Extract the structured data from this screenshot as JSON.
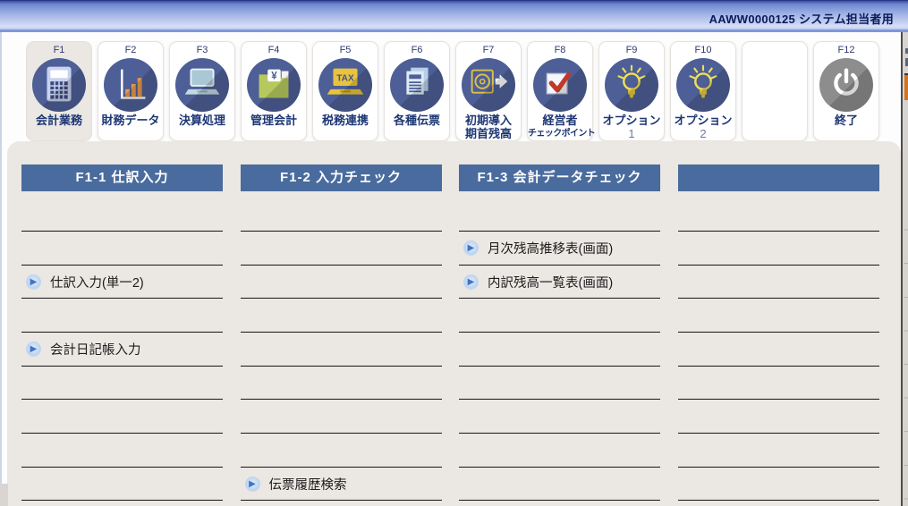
{
  "titlebar": {
    "label": "AAWW0000125 システム担当者用"
  },
  "tabs": [
    {
      "fkey": "F1",
      "label": "会計業務",
      "label2": "",
      "icon": "calculator-icon",
      "active": true
    },
    {
      "fkey": "F2",
      "label": "財務データ",
      "label2": "",
      "icon": "bar-chart-icon",
      "active": false
    },
    {
      "fkey": "F3",
      "label": "決算処理",
      "label2": "",
      "icon": "laptop-icon",
      "active": false
    },
    {
      "fkey": "F4",
      "label": "管理会計",
      "label2": "",
      "icon": "folder-yen-icon",
      "active": false
    },
    {
      "fkey": "F5",
      "label": "税務連携",
      "label2": "",
      "icon": "tax-laptop-icon",
      "active": false
    },
    {
      "fkey": "F6",
      "label": "各種伝票",
      "label2": "",
      "icon": "documents-icon",
      "active": false
    },
    {
      "fkey": "F7",
      "label": "初期導入",
      "label2": "期首残高",
      "icon": "disk-export-icon",
      "active": false
    },
    {
      "fkey": "F8",
      "label": "経営者",
      "label2": "チェックポイント",
      "icon": "checkbox-check-icon",
      "active": false
    },
    {
      "fkey": "F9",
      "label": "オプション",
      "label2": "1",
      "icon": "light-bulb-icon",
      "active": false
    },
    {
      "fkey": "F10",
      "label": "オプション",
      "label2": "2",
      "icon": "light-bulb-icon",
      "active": false
    },
    {
      "fkey": "",
      "label": "",
      "label2": "",
      "icon": "",
      "active": false
    },
    {
      "fkey": "F12",
      "label": "終了",
      "label2": "",
      "icon": "power-icon",
      "active": false
    }
  ],
  "columns": [
    {
      "header": "F1-1 仕訳入力",
      "rows": [
        "",
        "",
        "仕訳入力(単一2)",
        "",
        "会計日記帳入力",
        "",
        "",
        "",
        ""
      ]
    },
    {
      "header": "F1-2 入力チェック",
      "rows": [
        "",
        "",
        "",
        "",
        "",
        "",
        "",
        "",
        "伝票履歴検索"
      ]
    },
    {
      "header": "F1-3 会計データチェック",
      "rows": [
        "",
        "月次残高推移表(画面)",
        "内訳残高一覧表(画面)",
        "",
        "",
        "",
        "",
        "",
        ""
      ]
    },
    {
      "header": "",
      "rows": [
        "",
        "",
        "",
        "",
        "",
        "",
        "",
        "",
        ""
      ]
    }
  ],
  "colors": {
    "header_blue": "#4a6b9d",
    "panel_beige": "#ebe7e3",
    "icon_circle_navy": "#4d5f96",
    "bullet_blue": "#3f74c7",
    "titlebar_navy": "#0b1a5a",
    "sliver_orange": "#d4731f"
  }
}
